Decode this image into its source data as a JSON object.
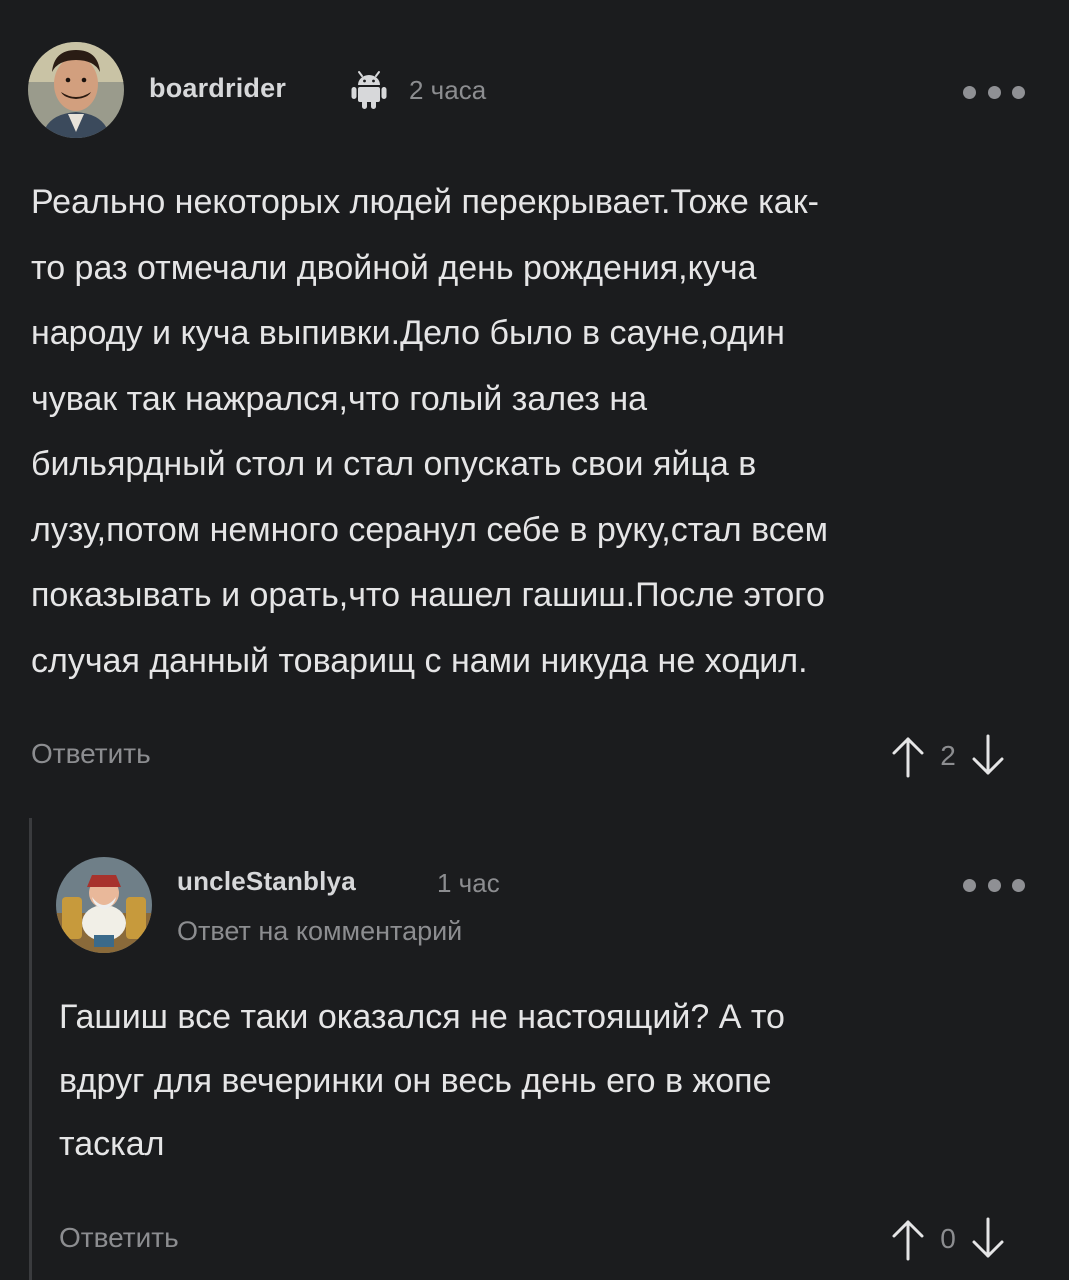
{
  "comments": [
    {
      "author": "boardrider",
      "platform_icon": "android-icon",
      "time": "2 часа",
      "body_lines": [
        "Реально некоторых людей перекрывает.Тоже как-",
        "то раз отмечали двойной день рождения,куча",
        "народу и куча выпивки.Дело было в сауне,один",
        "чувак так нажрался,что голый залез на",
        "бильярдный стол и стал опускать свои яйца в",
        "лузу,потом немного серанул себе в руку,стал всем",
        "показывать и орать,что нашел гашиш.После этого",
        "случая данный товарищ с нами никуда не ходил."
      ],
      "reply_label": "Ответить",
      "rating": "2"
    },
    {
      "author": "uncleStanblya",
      "time": "1 час",
      "subline": "Ответ на комментарий",
      "body_lines": [
        "Гашиш все таки оказался не настоящий? А то",
        "вдруг для вечеринки он весь день его в жопе",
        "таскал"
      ],
      "reply_label": "Ответить",
      "rating": "0"
    }
  ],
  "colors": {
    "background": "#1b1c1e",
    "text": "#e5e5e6",
    "muted": "#8c8d90",
    "thread_line": "#3a3b3e"
  }
}
